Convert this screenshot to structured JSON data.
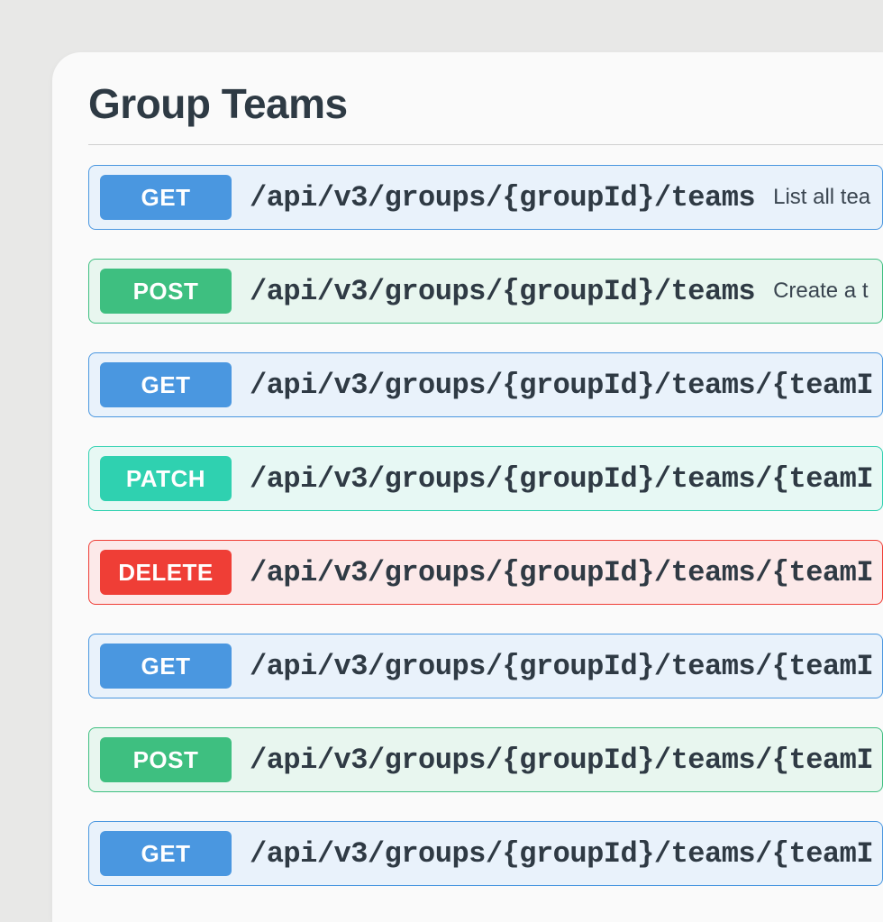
{
  "section": {
    "title": "Group Teams"
  },
  "endpoints": [
    {
      "method": "GET",
      "methodClass": "m-get",
      "rowClass": "row-get",
      "path": "/api/v3/groups/{groupId}/teams",
      "desc": "List all tea"
    },
    {
      "method": "POST",
      "methodClass": "m-post",
      "rowClass": "row-post",
      "path": "/api/v3/groups/{groupId}/teams",
      "desc": "Create a t"
    },
    {
      "method": "GET",
      "methodClass": "m-get",
      "rowClass": "row-get",
      "path": "/api/v3/groups/{groupId}/teams/{teamI",
      "desc": ""
    },
    {
      "method": "PATCH",
      "methodClass": "m-patch",
      "rowClass": "row-patch",
      "path": "/api/v3/groups/{groupId}/teams/{teamI",
      "desc": ""
    },
    {
      "method": "DELETE",
      "methodClass": "m-delete",
      "rowClass": "row-delete",
      "path": "/api/v3/groups/{groupId}/teams/{teamI",
      "desc": ""
    },
    {
      "method": "GET",
      "methodClass": "m-get",
      "rowClass": "row-get",
      "path": "/api/v3/groups/{groupId}/teams/{teamI",
      "desc": ""
    },
    {
      "method": "POST",
      "methodClass": "m-post",
      "rowClass": "row-post",
      "path": "/api/v3/groups/{groupId}/teams/{teamI",
      "desc": ""
    },
    {
      "method": "GET",
      "methodClass": "m-get",
      "rowClass": "row-get",
      "path": "/api/v3/groups/{groupId}/teams/{teamI",
      "desc": ""
    }
  ]
}
